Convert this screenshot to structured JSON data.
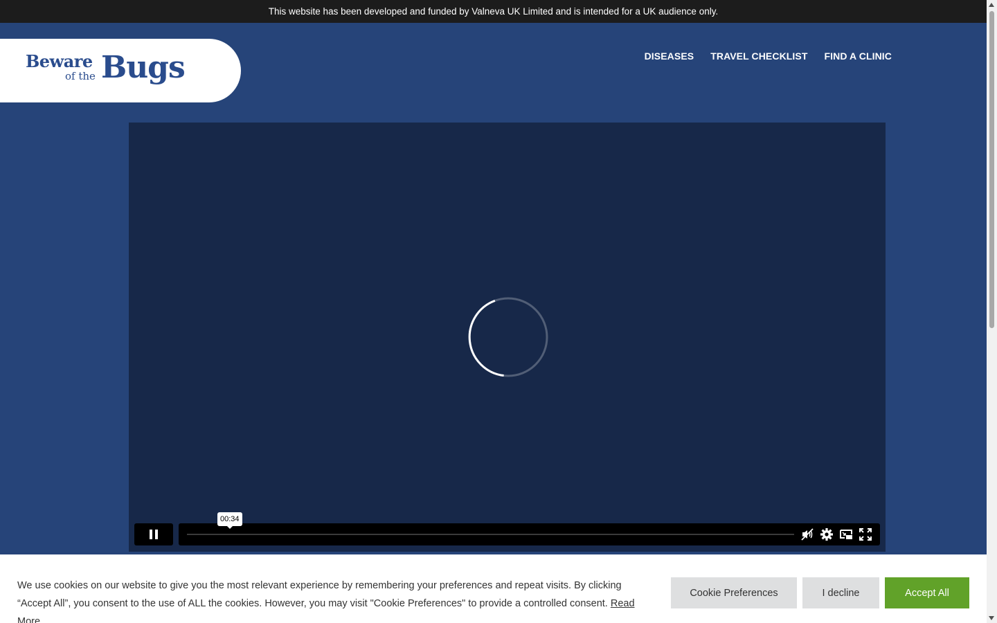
{
  "topbar": {
    "notice": "This website has been developed and funded by Valneva UK Limited and is intended for a UK audience only."
  },
  "logo": {
    "line1": "Beware",
    "line2": "of the",
    "line3": "Bugs"
  },
  "nav": {
    "items": [
      {
        "label": "DISEASES"
      },
      {
        "label": "TRAVEL CHECKLIST"
      },
      {
        "label": "FIND A CLINIC"
      }
    ]
  },
  "video": {
    "state": "loading",
    "time_tooltip": "00:34",
    "controls": {
      "play_pause_icon": "pause-icon",
      "mute_icon": "volume-muted-icon",
      "settings_icon": "gear-icon",
      "pip_icon": "picture-in-picture-icon",
      "fullscreen_icon": "fullscreen-icon"
    }
  },
  "cookie": {
    "message": "We use cookies on our website to give you the most relevant experience by remembering your preferences and repeat visits. By clicking “Accept All”, you consent to the use of ALL the cookies. However, you may visit \"Cookie Preferences\" to provide a controlled consent.",
    "read_more": "Read More",
    "preferences_label": "Cookie Preferences",
    "decline_label": "I decline",
    "accept_label": "Accept All"
  },
  "colors": {
    "header_bg": "#264479",
    "topbar_bg": "#1c1c1c",
    "video_bg": "#172849",
    "accept_green": "#61a229"
  }
}
